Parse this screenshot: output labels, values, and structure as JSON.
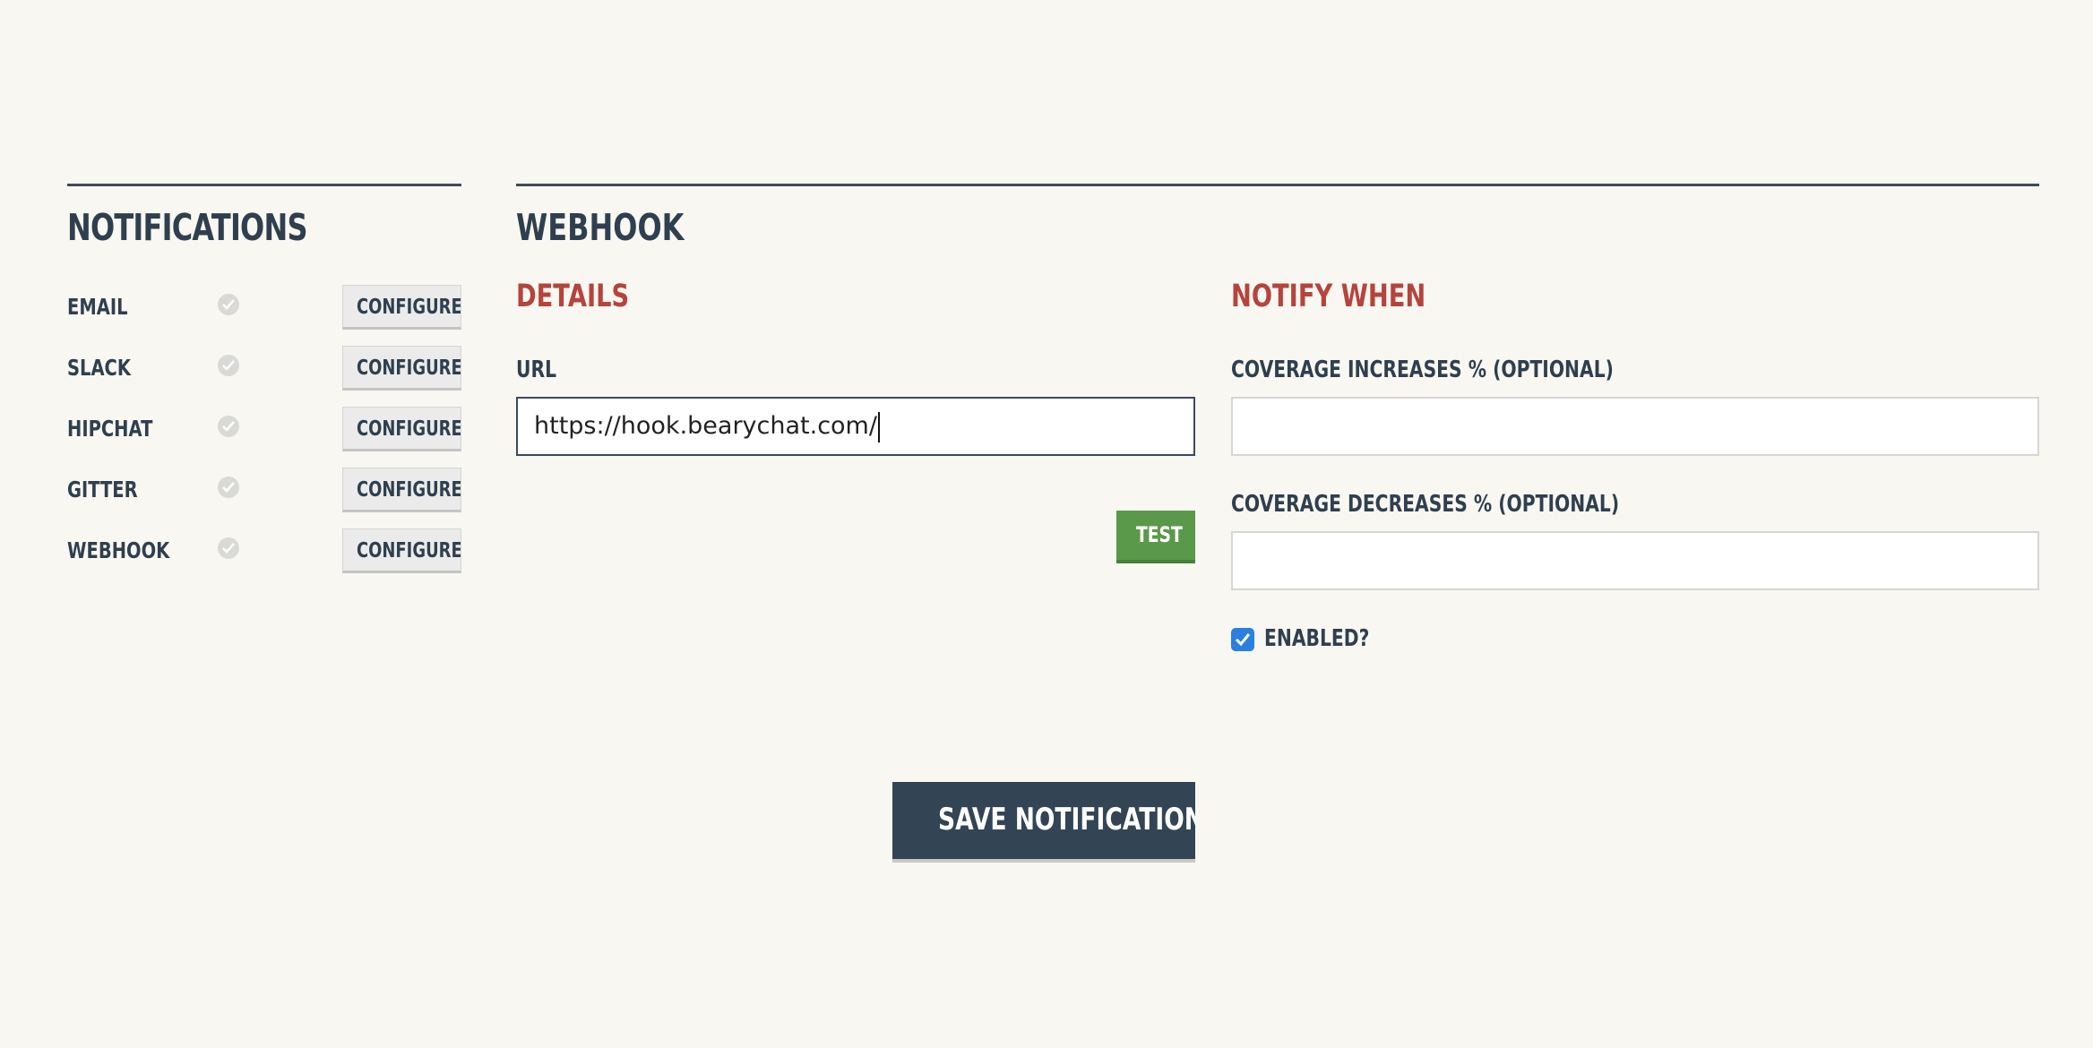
{
  "sidebar": {
    "title": "NOTIFICATIONS",
    "items": [
      {
        "label": "EMAIL",
        "button": "CONFIGURE"
      },
      {
        "label": "SLACK",
        "button": "CONFIGURE"
      },
      {
        "label": "HIPCHAT",
        "button": "CONFIGURE"
      },
      {
        "label": "GITTER",
        "button": "CONFIGURE"
      },
      {
        "label": "WEBHOOK",
        "button": "CONFIGURE"
      }
    ]
  },
  "main": {
    "title": "WEBHOOK",
    "details": {
      "heading": "DETAILS",
      "url_label": "URL",
      "url_value": "https://hook.bearychat.com/",
      "test_button": "TEST"
    },
    "notify": {
      "heading": "NOTIFY WHEN",
      "increase_label": "COVERAGE INCREASES % (OPTIONAL)",
      "increase_value": "",
      "decrease_label": "COVERAGE DECREASES % (OPTIONAL)",
      "decrease_value": "",
      "enabled_label": "ENABLED?",
      "enabled_checked": true
    },
    "save_button": "SAVE NOTIFICATION"
  },
  "colors": {
    "background": "#f9f7f1",
    "primary_text": "#2f3f4f",
    "accent_red": "#b5443d",
    "test_green": "#5a994a",
    "save_dark": "#334555",
    "checkbox_blue": "#2b7fe0"
  }
}
